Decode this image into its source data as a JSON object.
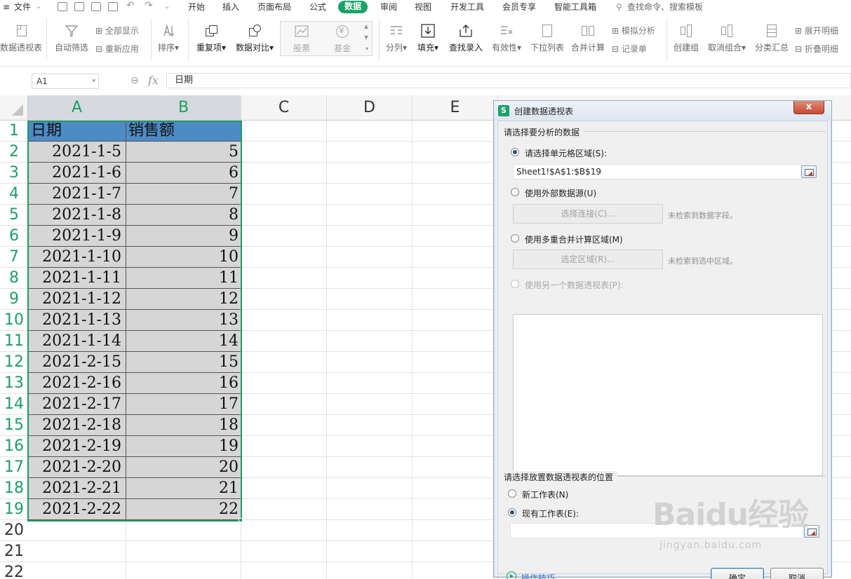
{
  "menubar": {
    "file": "文件",
    "tabs": [
      "开始",
      "插入",
      "页面布局",
      "公式",
      "数据",
      "审阅",
      "视图",
      "开发工具",
      "会员专享",
      "智能工具箱"
    ],
    "active_tab": "数据",
    "search": "查找命令、搜索模板"
  },
  "ribbon": {
    "pivot": "数据透视表",
    "autofilter": "自动筛选",
    "show_all": "全部显示",
    "reapply": "重新应用",
    "sort": "排序",
    "duplicates": "重复项",
    "compare": "数据对比",
    "stock": "股票",
    "fund": "基金",
    "split": "分列",
    "fill": "填充",
    "lookup_entry": "查找录入",
    "validity": "有效性",
    "dropdown": "下拉列表",
    "consolidate": "合并计算",
    "what_if": "模拟分析",
    "record": "记录单",
    "group": "创建组",
    "ungroup": "取消组合",
    "subtotal": "分类汇总",
    "expand_detail": "展开明细",
    "collapse_detail": "折叠明细"
  },
  "formula_bar": {
    "name_box": "A1",
    "fx": "fx",
    "content": "日期"
  },
  "sheet": {
    "columns": [
      "A",
      "B",
      "C",
      "D",
      "E"
    ],
    "rows": [
      "1",
      "2",
      "3",
      "4",
      "5",
      "6",
      "7",
      "8",
      "9",
      "10",
      "11",
      "12",
      "13",
      "14",
      "15",
      "16",
      "17",
      "18",
      "19",
      "20",
      "21",
      "22"
    ],
    "header": [
      "日期",
      "销售额"
    ],
    "data": [
      [
        "2021-1-5",
        "5"
      ],
      [
        "2021-1-6",
        "6"
      ],
      [
        "2021-1-7",
        "7"
      ],
      [
        "2021-1-8",
        "8"
      ],
      [
        "2021-1-9",
        "9"
      ],
      [
        "2021-1-10",
        "10"
      ],
      [
        "2021-1-11",
        "11"
      ],
      [
        "2021-1-12",
        "12"
      ],
      [
        "2021-1-13",
        "13"
      ],
      [
        "2021-1-14",
        "14"
      ],
      [
        "2021-2-15",
        "15"
      ],
      [
        "2021-2-16",
        "16"
      ],
      [
        "2021-2-17",
        "17"
      ],
      [
        "2021-2-18",
        "18"
      ],
      [
        "2021-2-19",
        "19"
      ],
      [
        "2021-2-20",
        "20"
      ],
      [
        "2021-2-21",
        "21"
      ],
      [
        "2021-2-22",
        "22"
      ]
    ]
  },
  "dialog": {
    "title": "创建数据透视表",
    "app_icon": "S",
    "close": "x",
    "section1": "请选择要分析的数据",
    "opt_range": "请选择单元格区域(S):",
    "range_value": "Sheet1!$A$1:$B$19",
    "opt_external": "使用外部数据源(U)",
    "select_connection": "选择连接(C)...",
    "no_fields": "未检索到数据字段。",
    "opt_multi": "使用多重合并计算区域(M)",
    "select_region": "选定区域(R)...",
    "no_region": "未检索到选中区域。",
    "opt_other_pivot": "使用另一个数据透视表(P):",
    "section2": "请选择放置数据透视表的位置",
    "opt_new_sheet": "新工作表(N)",
    "opt_existing": "现有工作表(E):",
    "existing_value": "",
    "tips": "操作技巧",
    "ok": "确定",
    "cancel": "取消"
  },
  "watermark": {
    "text": "Baidu经验",
    "sub": "jingyan.baidu.com"
  },
  "colors": {
    "accent": "#1aa366",
    "header_fill": "#4d8bc5",
    "data_fill": "#d6d6d6",
    "selection": "#1f9c67"
  }
}
